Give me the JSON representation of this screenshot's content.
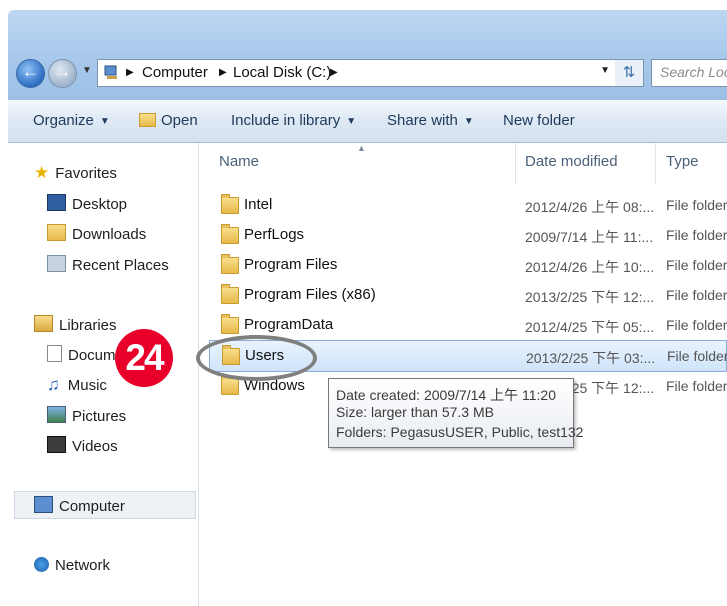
{
  "address": {
    "crumbs": [
      "Computer",
      "Local Disk (C:)"
    ],
    "search_placeholder": "Search Loca"
  },
  "toolbar": {
    "organize": "Organize",
    "open": "Open",
    "include_in_library": "Include in library",
    "share_with": "Share with",
    "new_folder": "New folder"
  },
  "sidebar": {
    "favorites": "Favorites",
    "desktop": "Desktop",
    "downloads": "Downloads",
    "recent_places": "Recent Places",
    "libraries": "Libraries",
    "documents": "Docum",
    "music": "Music",
    "pictures": "Pictures",
    "videos": "Videos",
    "computer": "Computer",
    "network": "Network"
  },
  "columns": {
    "name": "Name",
    "date_modified": "Date modified",
    "type": "Type"
  },
  "files": [
    {
      "name": "Intel",
      "date": "2012/4/26 上午 08:...",
      "type": "File folder"
    },
    {
      "name": "PerfLogs",
      "date": "2009/7/14 上午 11:...",
      "type": "File folder"
    },
    {
      "name": "Program Files",
      "date": "2012/4/26 上午 10:...",
      "type": "File folder"
    },
    {
      "name": "Program Files (x86)",
      "date": "2013/2/25 下午 12:...",
      "type": "File folder"
    },
    {
      "name": "ProgramData",
      "date": "2012/4/25 下午 05:...",
      "type": "File folder"
    },
    {
      "name": "Users",
      "date": "2013/2/25 下午 03:...",
      "type": "File folder",
      "selected": true
    },
    {
      "name": "Windows",
      "date": "2013/2/25 下午 12:...",
      "type": "File folder"
    }
  ],
  "tooltip": {
    "line1": "Date created: 2009/7/14 上午 11:20",
    "line2": "Size: larger than 57.3 MB",
    "line3": "Folders: PegasusUSER, Public, test132"
  },
  "step_badge": "24",
  "colors": {
    "badge": "#e8002a",
    "selection": "#cfe4fa",
    "toolbar": "#dde8f4"
  }
}
